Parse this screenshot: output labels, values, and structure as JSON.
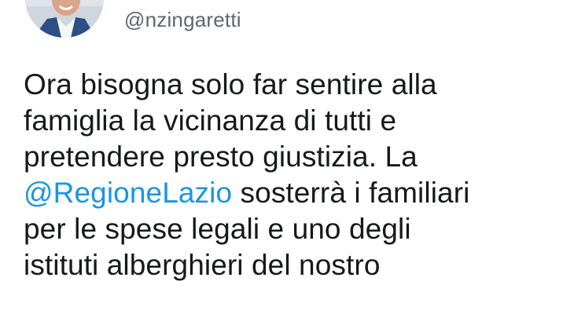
{
  "tweet": {
    "handle": "@nzingaretti",
    "lines": [
      {
        "text": "Ora bisogna solo far sentire alla"
      },
      {
        "text": "famiglia la vicinanza di tutti e"
      },
      {
        "text": "pretendere presto giustizia. La"
      },
      {
        "mention": "@RegioneLazio",
        "text": " sosterrà i familiari"
      },
      {
        "text": "per le spese legali e uno degli"
      },
      {
        "text": "istituti alberghieri del nostro"
      }
    ]
  },
  "colors": {
    "mention": "#1b95e0",
    "handle": "#5b6770",
    "text": "#16181b",
    "background": "#ffffff"
  },
  "icons": {
    "avatar": "profile-photo"
  }
}
